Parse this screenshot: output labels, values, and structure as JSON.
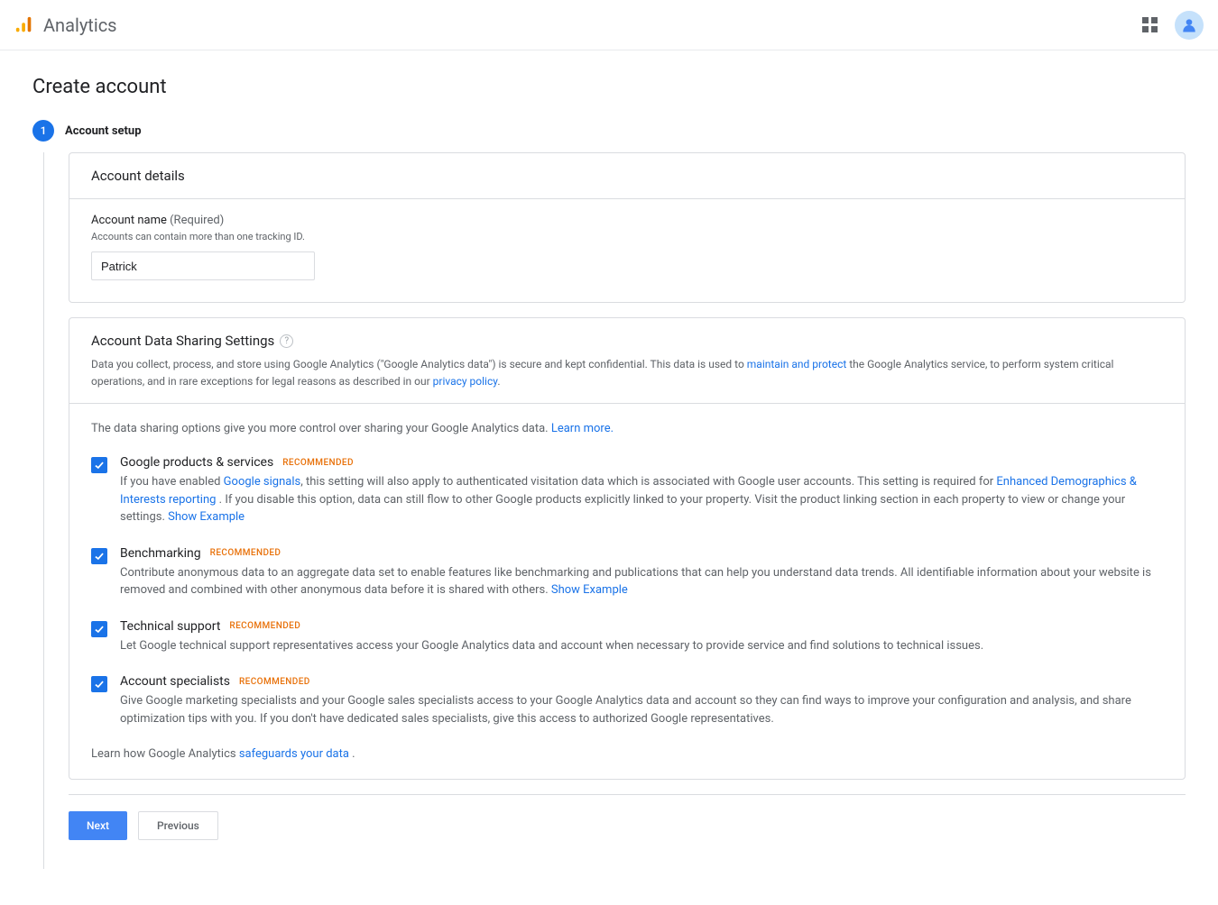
{
  "header": {
    "product_name": "Analytics"
  },
  "page": {
    "title": "Create account"
  },
  "step": {
    "number": "1",
    "label": "Account setup"
  },
  "account_details": {
    "heading": "Account details",
    "field_label": "Account name",
    "required": "(Required)",
    "hint": "Accounts can contain more than one tracking ID.",
    "value": "Patrick"
  },
  "sharing": {
    "heading": "Account Data Sharing Settings",
    "desc_pre": "Data you collect, process, and store using Google Analytics (\"Google Analytics data\") is secure and kept confidential. This data is used to ",
    "maintain_link": "maintain and protect",
    "desc_mid": " the Google Analytics service, to perform system critical operations, and in rare exceptions for legal reasons as described in our ",
    "privacy_link": "privacy policy",
    "desc_post": ".",
    "intro": "The data sharing options give you more control over sharing your Google Analytics data. ",
    "learn_more": "Learn more.",
    "recommended_label": "RECOMMENDED",
    "options": [
      {
        "title": "Google products & services",
        "desc_pre": "If you have enabled ",
        "link1": "Google signals",
        "desc_mid1": ", this setting will also apply to authenticated visitation data which is associated with Google user accounts. This setting is required for ",
        "link2": "Enhanced Demographics & Interests reporting",
        "desc_mid2": " . If you disable this option, data can still flow to other Google products explicitly linked to your property. Visit the product linking section in each property to view or change your settings. ",
        "show_example": "Show Example"
      },
      {
        "title": "Benchmarking",
        "desc": "Contribute anonymous data to an aggregate data set to enable features like benchmarking and publications that can help you understand data trends. All identifiable information about your website is removed and combined with other anonymous data before it is shared with others. ",
        "show_example": "Show Example"
      },
      {
        "title": "Technical support",
        "desc": "Let Google technical support representatives access your Google Analytics data and account when necessary to provide service and find solutions to technical issues."
      },
      {
        "title": "Account specialists",
        "desc": "Give Google marketing specialists and your Google sales specialists access to your Google Analytics data and account so they can find ways to improve your configuration and analysis, and share optimization tips with you. If you don't have dedicated sales specialists, give this access to authorized Google representatives."
      }
    ],
    "safeguard_pre": "Learn how Google Analytics ",
    "safeguard_link": "safeguards your data",
    "safeguard_post": " ."
  },
  "buttons": {
    "next": "Next",
    "previous": "Previous"
  }
}
